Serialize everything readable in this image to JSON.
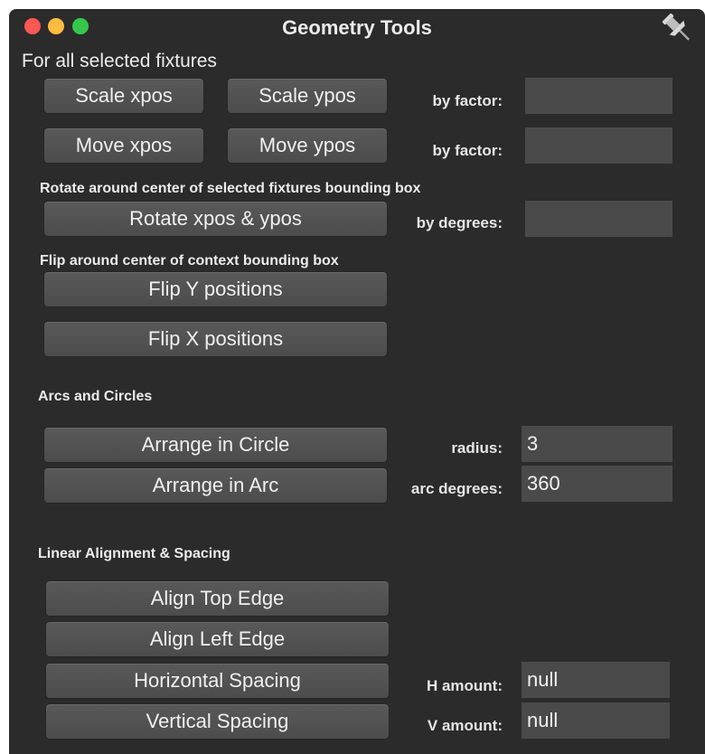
{
  "window": {
    "title": "Geometry Tools"
  },
  "heading": "For all selected fixtures",
  "scale": {
    "xpos_button": "Scale xpos",
    "ypos_button": "Scale ypos",
    "factor_label": "by factor:",
    "factor_value": ""
  },
  "move": {
    "xpos_button": "Move xpos",
    "ypos_button": "Move ypos",
    "factor_label": "by factor:",
    "factor_value": ""
  },
  "rotate": {
    "section": "Rotate around center of selected fixtures bounding box",
    "button": "Rotate xpos & ypos",
    "degrees_label": "by degrees:",
    "degrees_value": ""
  },
  "flip": {
    "section": "Flip around center of context bounding box",
    "y_button": "Flip Y positions",
    "x_button": "Flip X positions"
  },
  "arcs": {
    "section": "Arcs and Circles",
    "circle_button": "Arrange in Circle",
    "arc_button": "Arrange in Arc",
    "radius_label": "radius:",
    "radius_value": "3",
    "arc_degrees_label": "arc degrees:",
    "arc_degrees_value": "360"
  },
  "linear": {
    "section": "Linear Alignment & Spacing",
    "top_button": "Align Top Edge",
    "left_button": "Align Left Edge",
    "hspacing_button": "Horizontal Spacing",
    "vspacing_button": "Vertical Spacing",
    "h_label": "H amount:",
    "h_value": "null",
    "v_label": "V amount:",
    "v_value": "null"
  },
  "icons": {
    "close": "close-icon",
    "minimize": "minimize-icon",
    "zoom": "zoom-icon",
    "pin": "pushpin-icon"
  },
  "colors": {
    "background": "#2b2b2b",
    "button": "#525252",
    "field": "#4a4a4a",
    "text": "#ececec",
    "close": "#fc5753",
    "minimize": "#fdbc40",
    "zoom": "#34c84a"
  }
}
